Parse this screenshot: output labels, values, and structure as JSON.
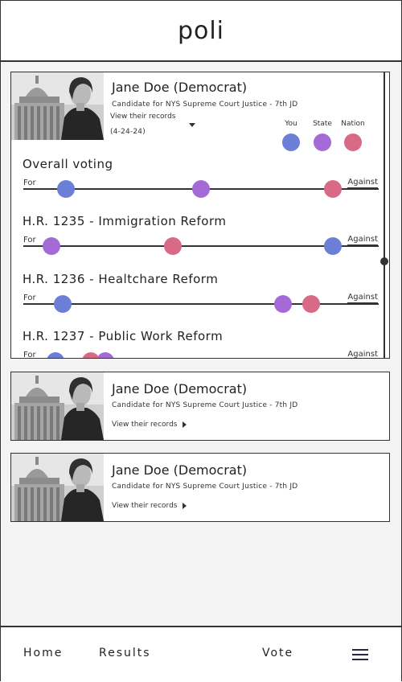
{
  "app": {
    "title": "poli"
  },
  "colors": {
    "you": "#6b7fd7",
    "state": "#a46bd6",
    "nation": "#d96a86"
  },
  "legend": {
    "you": "You",
    "state": "State",
    "nation": "Nation"
  },
  "candidates": [
    {
      "name": "Jane Doe (Democrat)",
      "subtitle": "Candidate for NYS Supreme Court Justice - 7th JD",
      "records_label": "View their records",
      "records_date": "(4-24-24)"
    },
    {
      "name": "Jane Doe (Democrat)",
      "subtitle": "Candidate for NYS Supreme Court Justice - 7th JD",
      "records_label": "View their records"
    },
    {
      "name": "Jane Doe (Democrat)",
      "subtitle": "Candidate for NYS Supreme Court Justice - 7th JD",
      "records_label": "View their records"
    }
  ],
  "voting": {
    "for_label": "For",
    "against_label": "Against",
    "rows": [
      {
        "title": "Overall voting",
        "you": 0.12,
        "state": 0.5,
        "nation": 0.87
      },
      {
        "title": "H.R. 1235 - Immigration Reform",
        "you": 0.87,
        "state": 0.08,
        "nation": 0.42
      },
      {
        "title": "H.R. 1236 - Healtchare Reform",
        "you": 0.11,
        "state": 0.73,
        "nation": 0.81
      },
      {
        "title": "H.R. 1237 - Public Work Reform",
        "you": 0.09,
        "state": 0.23,
        "nation": 0.19
      }
    ]
  },
  "nav": {
    "home": "Home",
    "results": "Results",
    "vote": "Vote",
    "menu_icon": "hamburger-menu-icon"
  }
}
